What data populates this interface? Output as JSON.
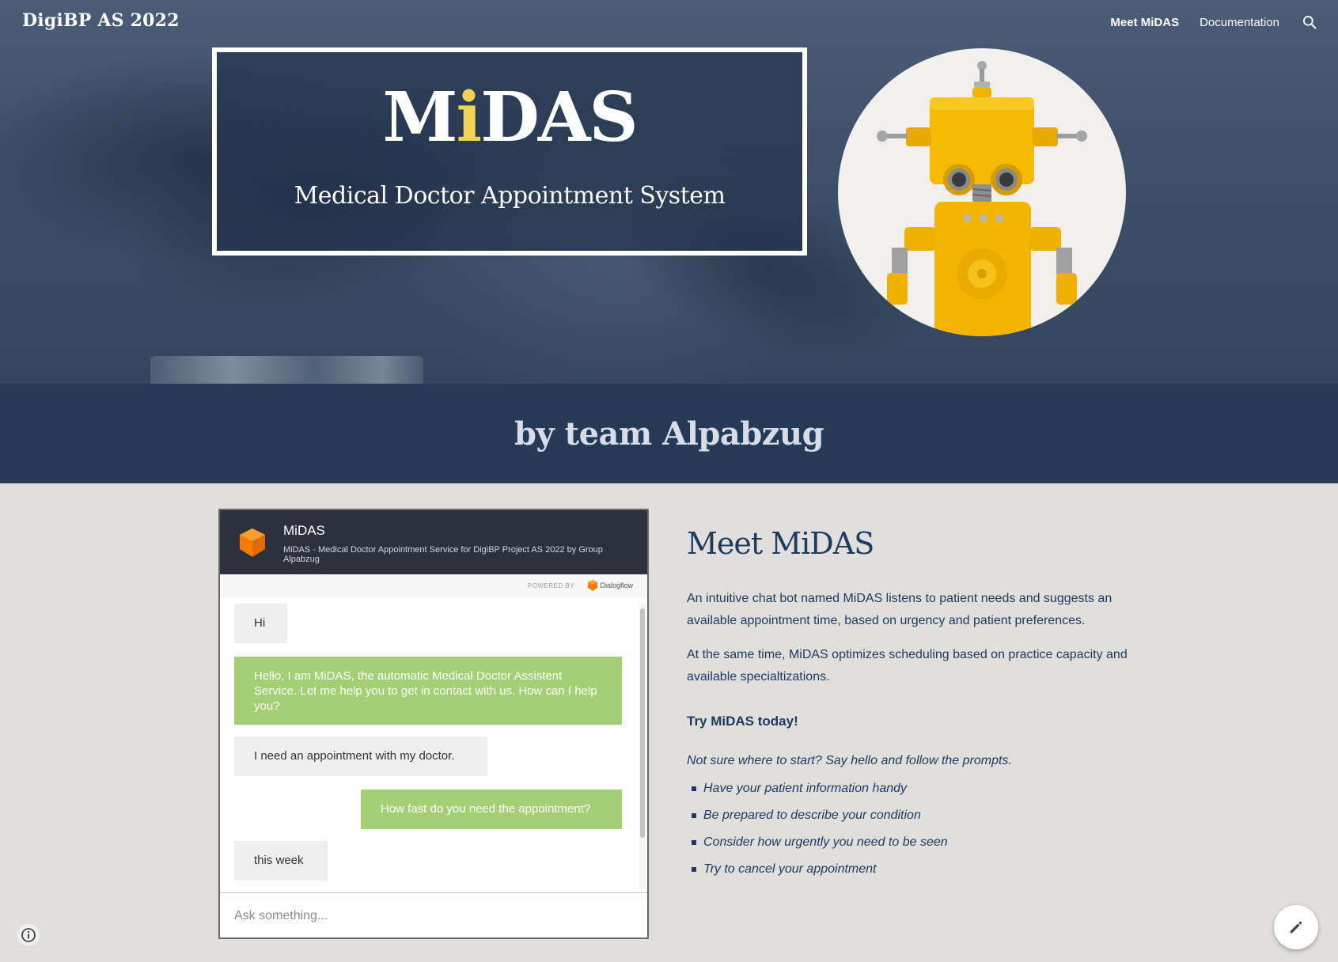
{
  "site": {
    "title": "DigiBP AS 2022"
  },
  "nav": {
    "items": [
      {
        "label": "Meet MiDAS",
        "active": true
      },
      {
        "label": "Documentation",
        "active": false
      }
    ],
    "search_icon": "search-icon"
  },
  "hero": {
    "logo_pre": "M",
    "logo_accent": "i",
    "logo_post": "DAS",
    "subtitle": "Medical Doctor Appointment System",
    "image": "yellow-robot"
  },
  "team": {
    "text": "by team Alpabzug"
  },
  "chat": {
    "agent_name": "MiDAS",
    "agent_description": "MiDAS - Medical Doctor Appointment Service for DigiBP Project AS 2022 by Group Alpabzug",
    "powered_by": "POWERED BY",
    "provider": "Dialogflow",
    "messages": [
      {
        "from": "user",
        "text": "Hi"
      },
      {
        "from": "bot",
        "text": "Hello, I am MiDAS, the automatic Medical Doctor Assistent Service. Let me help you to get in contact with us. How can I help you?"
      },
      {
        "from": "user",
        "text": "I need an appointment with my doctor."
      },
      {
        "from": "bot",
        "text": "How fast do you need the appointment?"
      },
      {
        "from": "user",
        "text": "this week"
      }
    ],
    "input_placeholder": "Ask something..."
  },
  "content": {
    "heading": "Meet MiDAS",
    "paragraph1": "An intuitive chat bot named MiDAS listens to patient needs and suggests an available appointment time, based on urgency and patient preferences.",
    "paragraph2": "At the same time, MiDAS optimizes scheduling based on practice capacity and available specialtizations.",
    "cta": "Try MiDAS today!",
    "hint": "Not sure where to start? Say hello and follow the prompts.",
    "tips": [
      "Have your patient information handy",
      "Be prepared to describe your condition",
      "Consider how urgently you need to be seen",
      "Try to cancel your appointment"
    ]
  },
  "colors": {
    "hero_bg": "#3e5069",
    "team_band": "#243a55",
    "accent_yellow": "#f3d25a",
    "bot_bubble": "#a5cf74",
    "user_bubble": "#eeeeee",
    "text_navy": "#1e3a62",
    "page_bg": "#e0dfdb"
  }
}
